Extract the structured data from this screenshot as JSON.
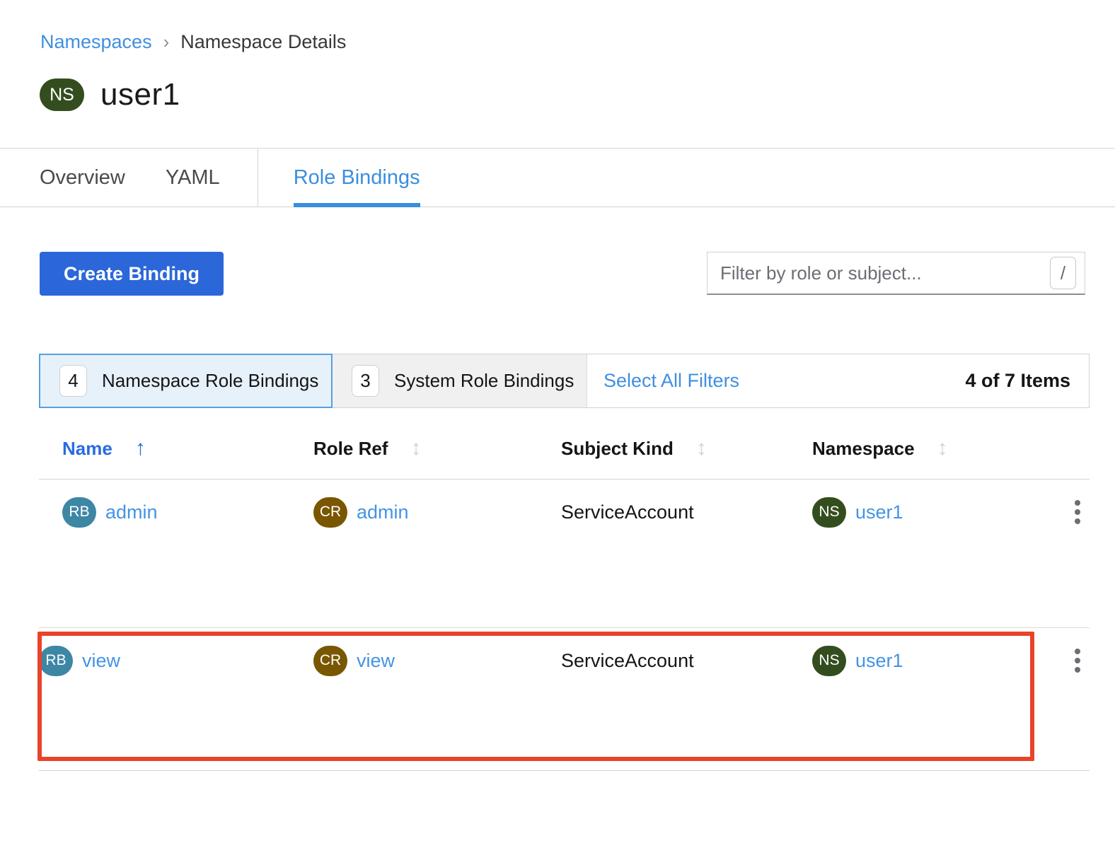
{
  "breadcrumb": {
    "separator": "›",
    "items": [
      {
        "label": "Namespaces"
      },
      {
        "label": "Namespace Details"
      }
    ]
  },
  "page": {
    "title": "user1",
    "title_badge": "NS"
  },
  "tabs": {
    "items": [
      {
        "label": "Overview"
      },
      {
        "label": "YAML"
      },
      {
        "label": "Role Bindings"
      }
    ],
    "active": "Role Bindings"
  },
  "toolbar": {
    "create_button_label": "Create Binding",
    "filter_placeholder": "Filter by role or subject...",
    "filter_shortcut_key": "/"
  },
  "filter_bar": {
    "chips": [
      {
        "count": "4",
        "label": "Namespace Role Bindings",
        "selected": true
      },
      {
        "count": "3",
        "label": "System Role Bindings",
        "selected": false
      }
    ],
    "select_all_label": "Select All Filters",
    "items_summary": "4 of 7 Items"
  },
  "table": {
    "columns": [
      {
        "label": "Name",
        "sort": "ascending"
      },
      {
        "label": "Role Ref",
        "sort": "none"
      },
      {
        "label": "Subject Kind",
        "sort": "none"
      },
      {
        "label": "Namespace",
        "sort": "none"
      }
    ],
    "rows": [
      {
        "name": {
          "badge": "RB",
          "label": "admin"
        },
        "role_ref": {
          "badge": "CR",
          "label": "admin"
        },
        "subject_kind": "ServiceAccount",
        "namespace": {
          "badge": "NS",
          "label": "user1"
        },
        "highlighted": false
      },
      {
        "name": {
          "badge": "RB",
          "label": "view"
        },
        "role_ref": {
          "badge": "CR",
          "label": "view"
        },
        "subject_kind": "ServiceAccount",
        "namespace": {
          "badge": "NS",
          "label": "user1"
        },
        "highlighted": true
      }
    ]
  },
  "icons": {
    "sort_ascending": "↑",
    "sort_both": "↕"
  },
  "colors": {
    "accent_blue": "#2a6ce0",
    "link_blue": "#4394e5",
    "tab_blue": "#3a8edd",
    "ns_badge_green": "#344d1e",
    "rb_badge_teal": "#3d87a5",
    "cr_badge_gold": "#795600",
    "highlight_red": "#e8432b",
    "chip_selected_bg": "#e7f1fa",
    "chip_selected_border": "#56a0e0"
  }
}
